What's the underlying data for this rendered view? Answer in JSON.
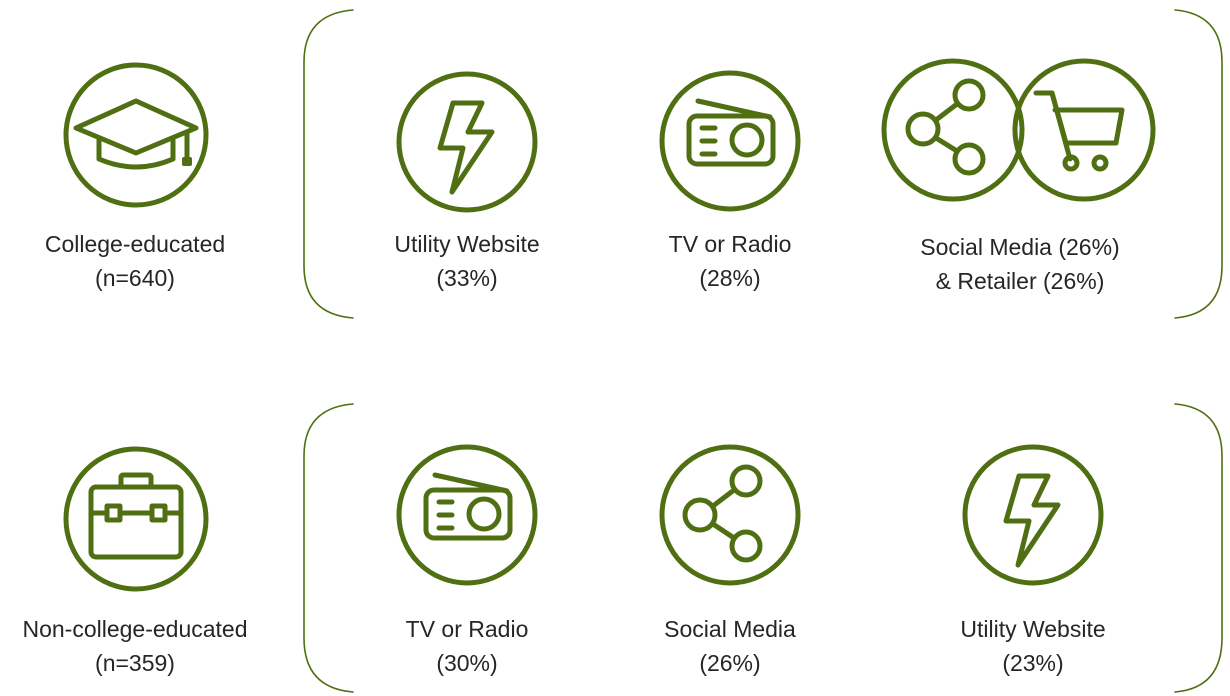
{
  "theme": {
    "icon_color": "#4f6f12",
    "text_color": "#262626"
  },
  "rows": [
    {
      "segment": {
        "icon": "graduation-cap-icon",
        "line1": "College-educated",
        "line2": "(n=640)"
      },
      "channels": [
        {
          "icon": "lightning-bolt-icon",
          "line1": "Utility Website",
          "line2": "(33%)"
        },
        {
          "icon": "radio-icon",
          "line1": "TV or Radio",
          "line2": "(28%)"
        },
        {
          "icon": "share-and-cart-icon",
          "line1": "Social Media (26%)",
          "line2": "& Retailer (26%)"
        }
      ]
    },
    {
      "segment": {
        "icon": "briefcase-icon",
        "line1": "Non-college-educated",
        "line2": "(n=359)"
      },
      "channels": [
        {
          "icon": "radio-icon",
          "line1": "TV or Radio",
          "line2": "(30%)"
        },
        {
          "icon": "share-icon",
          "line1": "Social Media",
          "line2": "(26%)"
        },
        {
          "icon": "lightning-bolt-icon",
          "line1": "Utility Website",
          "line2": "(23%)"
        }
      ]
    }
  ]
}
